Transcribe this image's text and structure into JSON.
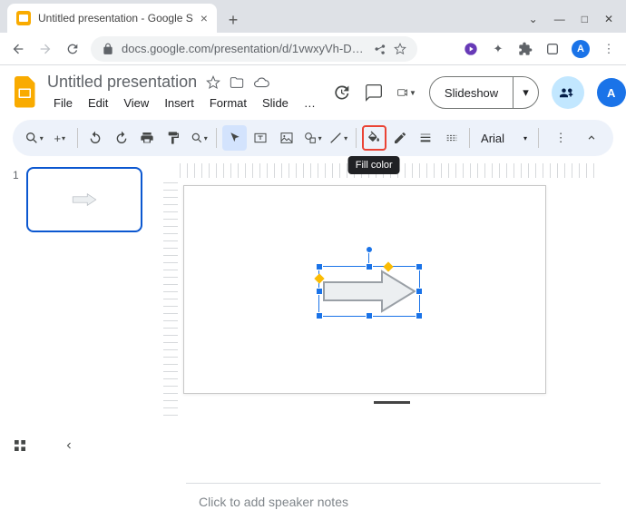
{
  "browser": {
    "tab_title": "Untitled presentation - Google S",
    "url": "docs.google.com/presentation/d/1vwxyVh-D8i0tu2aL_vfNHfpQ…",
    "user_initial": "A"
  },
  "header": {
    "doc_title": "Untitled presentation",
    "menus": [
      "File",
      "Edit",
      "View",
      "Insert",
      "Format",
      "Slide",
      "…"
    ],
    "slideshow_label": "Slideshow",
    "user_initial": "A"
  },
  "toolbar": {
    "font": "Arial",
    "tooltip": "Fill color"
  },
  "filmstrip": {
    "slides": [
      {
        "number": "1"
      }
    ]
  },
  "notes": {
    "placeholder": "Click to add speaker notes"
  }
}
